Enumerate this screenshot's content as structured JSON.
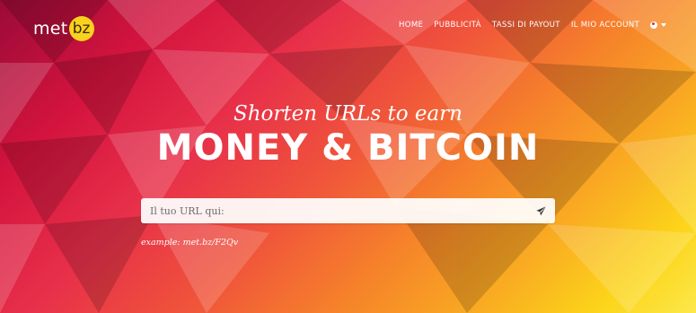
{
  "brand": {
    "name_prefix": "met",
    "name_badge": "bz",
    "badge_color": "#f9d21e"
  },
  "nav": {
    "items": [
      {
        "label": "HOME"
      },
      {
        "label": "PUBBLICITÀ"
      },
      {
        "label": "TASSI DI PAYOUT"
      },
      {
        "label": "IL MIO ACCOUNT"
      }
    ],
    "language_icon": "globe-icon"
  },
  "hero": {
    "tagline": "Shorten URLs to earn",
    "headline": "MONEY & BITCOIN",
    "gradient_colors": [
      "#9b0a38",
      "#d4143e",
      "#f0563a",
      "#f9ab22",
      "#fde84a"
    ]
  },
  "shorten_form": {
    "placeholder": "Il tuo URL qui:",
    "value": "",
    "submit_icon": "paper-plane-icon"
  },
  "example_text": "example: met.bz/F2Qv"
}
